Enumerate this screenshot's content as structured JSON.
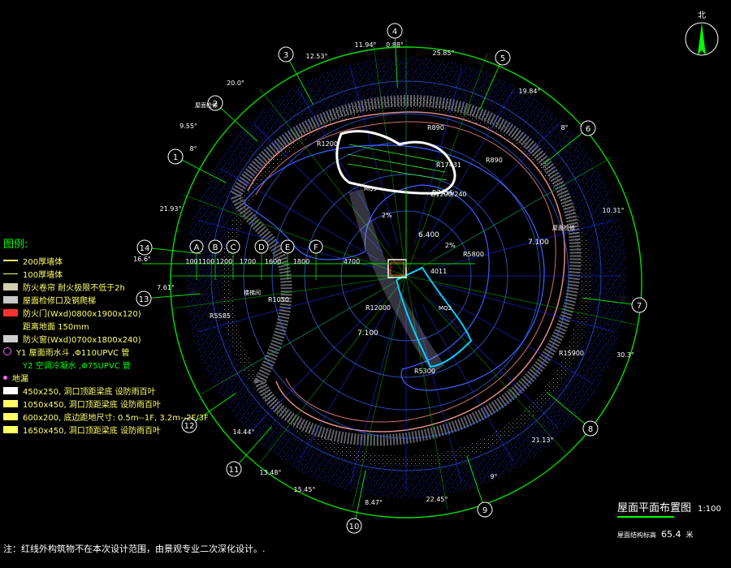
{
  "drawing": {
    "title": "屋面平面布置图",
    "scale": "1:100",
    "elevation_label": "屋面结构标高",
    "elevation_value": "65.4",
    "elevation_unit": "米",
    "north": "北",
    "note": "注：红线外构筑物不在本次设计范围，由景观专业二次深化设计。."
  },
  "legend": {
    "title": "图例:",
    "items": [
      {
        "text": "200厚墙体",
        "color": "#ffff66"
      },
      {
        "text": "100厚墙体",
        "color": "#ffff66"
      },
      {
        "text": "防火卷帘 耐火极限不低于2h",
        "color": "#ffff66"
      },
      {
        "text": "屋面检修口及钢爬梯",
        "color": "#ffff66"
      },
      {
        "text": "防火门(Wxd)0800x1900x120)",
        "color": "#ffff66"
      },
      {
        "text": "距离地面 150mm",
        "color": "#ffff66"
      },
      {
        "text": "防火窗(Wxd)0700x1800x240)",
        "color": "#ffff66"
      },
      {
        "text": "Y1 屋面雨水斗 ,Φ110UPVC 管",
        "color": "#ffff66"
      },
      {
        "text": "Y2 空调冷凝水 ,Φ75UPVC 管",
        "color": "#00ff00"
      },
      {
        "text": "地漏",
        "color": "#ffff66"
      },
      {
        "text": "450x250, 洞口顶距梁底 设防雨百叶",
        "color": "#ffff66"
      },
      {
        "text": "1050x450, 洞口顶距梁底 设防雨百叶",
        "color": "#ffff66"
      },
      {
        "text": "600x200, 底边距地尺寸: 0.5m--1F, 3.2m--2F/3F",
        "color": "#ffff66"
      },
      {
        "text": "1650x450, 洞口顶距梁底 设防雨百叶",
        "color": "#ffff66"
      }
    ]
  },
  "axes": {
    "radial": [
      "1",
      "2",
      "3",
      "4",
      "5",
      "6",
      "7",
      "8",
      "9",
      "10",
      "11",
      "12",
      "13",
      "14"
    ],
    "lettered": [
      "A",
      "B",
      "C",
      "D",
      "E",
      "F"
    ]
  },
  "angles": [
    "8°",
    "9.55°",
    "20.0°",
    "12.53°",
    "11.94°",
    "0.88°",
    "25.85°",
    "19.84°",
    "8°",
    "21.93°",
    "10.31°",
    "30.3°",
    "21.13°",
    "9°",
    "22.45°",
    "8.47°",
    "15.45°",
    "13.48°",
    "14.44°",
    "16.6°",
    "7.61°"
  ],
  "dims": {
    "row": [
      "100",
      "1100",
      "1200",
      "1700",
      "1600",
      "1800",
      "4700",
      "4011"
    ],
    "labels": [
      "R1200",
      "R890",
      "R890",
      "R17431",
      "R7456",
      "R5800",
      "R1050",
      "R12000",
      "R5585",
      "R5300",
      "R15900",
      "Ø1200/240"
    ],
    "levels": [
      "6.400",
      "7.100",
      "7.100"
    ],
    "slopes": [
      "2%",
      "2%"
    ],
    "rooms": [
      "MQ3",
      "MQ2",
      "屋面检修",
      "屋面检修",
      "楼梯间"
    ]
  }
}
